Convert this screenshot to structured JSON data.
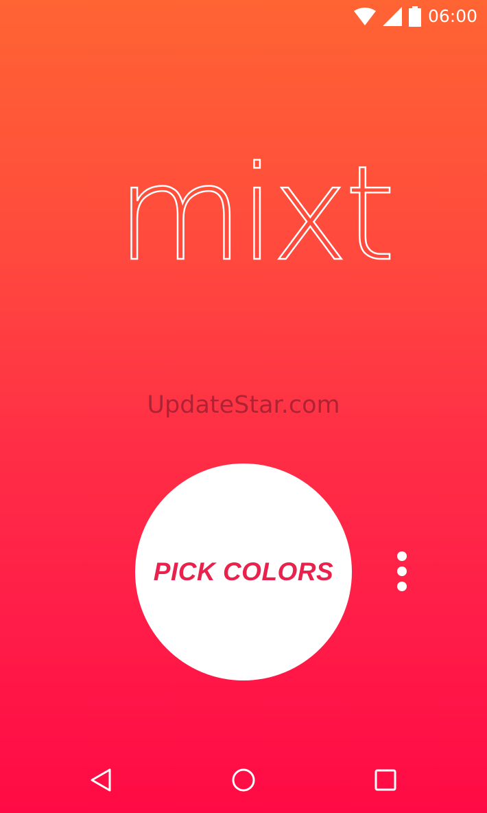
{
  "status_bar": {
    "time": "06:00",
    "icons": [
      "wifi-icon",
      "cellular-signal-icon",
      "battery-icon"
    ]
  },
  "logo": {
    "text": "mixt"
  },
  "watermark": {
    "text": "UpdateStar.com"
  },
  "main": {
    "pick_button_label": "PICK COLORS",
    "overflow_icon": "more-vert-icon"
  },
  "nav_bar": {
    "icons": [
      "back-icon",
      "home-icon",
      "recent-apps-icon"
    ]
  },
  "colors": {
    "gradient_top": "#ff6433",
    "gradient_bottom": "#ff0a45",
    "accent_text": "#e8224c",
    "button_background": "#ffffff"
  }
}
